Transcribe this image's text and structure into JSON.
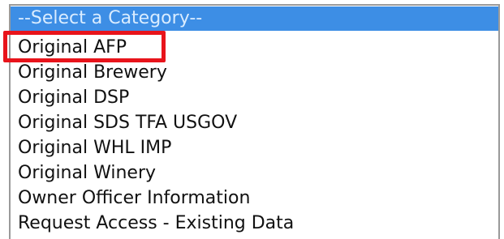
{
  "category_select": {
    "options": [
      {
        "label": "--Select a Category--",
        "selected": true
      },
      {
        "label": "Original AFP",
        "selected": false
      },
      {
        "label": "Original Brewery",
        "selected": false
      },
      {
        "label": "Original DSP",
        "selected": false
      },
      {
        "label": "Original SDS TFA USGOV",
        "selected": false
      },
      {
        "label": "Original WHL IMP",
        "selected": false
      },
      {
        "label": "Original Winery",
        "selected": false
      },
      {
        "label": "Owner Officer Information",
        "selected": false
      },
      {
        "label": "Request Access - Existing Data",
        "selected": false
      }
    ],
    "highlighted_option": "Original AFP"
  },
  "colors": {
    "selected_background": "#3d8ee5",
    "selected_text": "#d9ecff",
    "annotation_border": "#e8141b",
    "listbox_border": "#9a9a9a"
  }
}
